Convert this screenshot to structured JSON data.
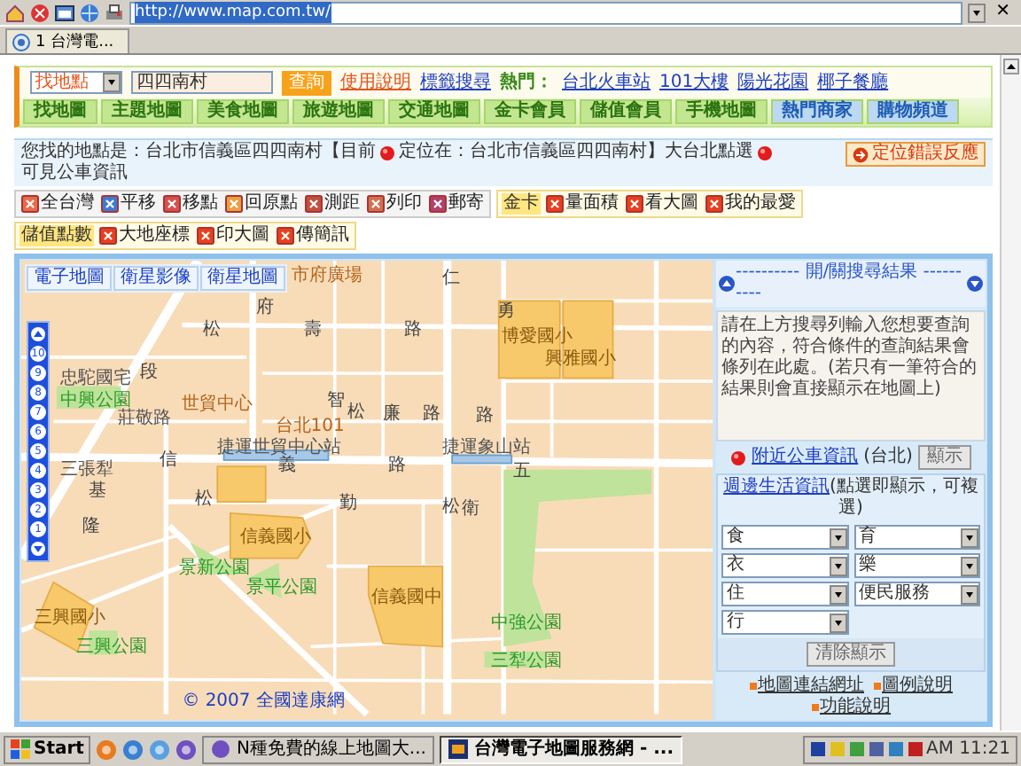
{
  "browser": {
    "address": "http://www.map.com.tw/",
    "close": "✕",
    "tab": "1 台灣電..."
  },
  "search": {
    "category": "找地點",
    "value": "四四南村",
    "button": "查詢",
    "help_link": "使用說明",
    "tag_link": "標籤搜尋",
    "hot_label": "熱門：",
    "hot_links": [
      "台北火車站",
      "101大樓",
      "陽光花園",
      "椰子餐廳"
    ]
  },
  "nav_tabs": [
    {
      "label": "找地圖",
      "kind": "green"
    },
    {
      "label": "主題地圖",
      "kind": "green"
    },
    {
      "label": "美食地圖",
      "kind": "green"
    },
    {
      "label": "旅遊地圖",
      "kind": "green"
    },
    {
      "label": "交通地圖",
      "kind": "green"
    },
    {
      "label": "金卡會員",
      "kind": "green"
    },
    {
      "label": "儲值會員",
      "kind": "green"
    },
    {
      "label": "手機地圖",
      "kind": "green"
    },
    {
      "label": "熱門商家",
      "kind": "blue"
    },
    {
      "label": "購物頻道",
      "kind": "blue"
    }
  ],
  "location_info": {
    "parts": [
      "您找的地點是：台北市信義區四四南村【目前",
      "定位在：台北市信義區四四南村】大台北點選",
      "可見公車資訊"
    ],
    "report_button": "定位錯誤反應"
  },
  "toolbar_groups": [
    {
      "tools": [
        "全台灣",
        "平移",
        "移點",
        "回原點",
        "測距",
        "列印",
        "郵寄"
      ]
    },
    {
      "label": "金卡",
      "tools": [
        "量面積",
        "看大圖",
        "我的最愛"
      ]
    },
    {
      "label": "儲值點數",
      "tools": [
        "大地座標",
        "印大圖",
        "傳簡訊"
      ]
    }
  ],
  "map": {
    "tabs": [
      "電子地圖",
      "衛星影像",
      "衛星地圖"
    ],
    "zoom_levels": [
      "10",
      "9",
      "8",
      "7",
      "6",
      "5",
      "4",
      "3",
      "2",
      "1"
    ],
    "labels": [
      "市府廣場",
      "博愛國小",
      "興雅國小",
      "忠駝國宅",
      "中興公園",
      "世貿中心",
      "莊敬路",
      "台北101",
      "捷運世貿中心站",
      "捷運象山站",
      "三張犁",
      "信義國小",
      "景新公園",
      "景平公園",
      "信義國中",
      "三興國小",
      "中強公園",
      "三興公園",
      "三犁公園"
    ],
    "road_labels": [
      "仁",
      "府",
      "勇",
      "松",
      "壽",
      "路",
      "段",
      "智",
      "松",
      "廉",
      "路",
      "路",
      "信",
      "義",
      "路",
      "五",
      "基",
      "松",
      "勤",
      "松",
      "衛",
      "隆"
    ],
    "copyright": "© 2007 全國達康網"
  },
  "results_panel": {
    "title": "---------- 開/關搜尋結果 ----------",
    "message": "請在上方搜尋列輸入您想要查詢的內容，符合條件的查詢結果會條列在此處。(若只有一筆符合的結果則會直接顯示在地圖上)",
    "bus_info": "附近公車資訊",
    "bus_note": "(台北)",
    "show_button": "顯示",
    "life_title_link": "週邊生活資訊",
    "life_title_note": "(點選即顯示，可複選)",
    "selects": [
      "食",
      "育",
      "衣",
      "樂",
      "住",
      "便民服務",
      "行"
    ],
    "clear_button": "清除顯示",
    "footer_links": [
      "地圖連結網址",
      "圖例說明",
      "功能說明"
    ]
  },
  "taskbar": {
    "start": "Start",
    "tasks": [
      {
        "label": "N種免費的線上地圖大...",
        "selected": false
      },
      {
        "label": "台灣電子地圖服務網 - ...",
        "selected": true
      }
    ],
    "clock": "AM 11:21"
  }
}
